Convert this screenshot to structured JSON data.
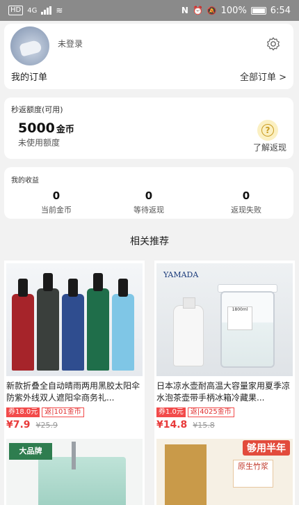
{
  "status_bar": {
    "left_chip": "HD",
    "network": "4G",
    "battery": "100%",
    "time": "6:54"
  },
  "profile": {
    "login_status": "未登录",
    "orders_title": "我的订单",
    "all_orders": "全部订单 >"
  },
  "rebate": {
    "title": "秒返额度(可用)",
    "amount": "5000",
    "unit": "金币",
    "subtitle": "未使用额度",
    "help_label": "了解返现"
  },
  "earnings": {
    "title": "我的收益",
    "items": [
      {
        "value": "0",
        "label": "当前金币"
      },
      {
        "value": "0",
        "label": "等待返现"
      },
      {
        "value": "0",
        "label": "返现失败"
      }
    ]
  },
  "recommend_title": "相关推荐",
  "products": [
    {
      "title": "新款折叠全自动晴雨两用黑胶太阳伞防紫外线双人遮阳伞商务礼...",
      "coupon": "券18.0元",
      "rebate_prefix": "返",
      "rebate": "101金币",
      "price": "¥7.9",
      "original_price": "¥25.9",
      "image": "umbrellas",
      "colors": [
        "#a6242a",
        "#3a3f3c",
        "#2f4d8f",
        "#1f6e4a",
        "#7fc6e6"
      ]
    },
    {
      "title": "日本凉水壶耐高温大容量家用夏季凉水泡茶壶带手柄冰箱冷藏果...",
      "coupon": "券1.0元",
      "rebate_prefix": "返",
      "rebate": "4025金币",
      "price": "¥14.8",
      "original_price": "¥15.8",
      "image": "kettle",
      "brand": "YAMADA",
      "jar_label": "1800ml"
    },
    {
      "image": "mop-bucket",
      "badge": "大品牌"
    },
    {
      "image": "tissues",
      "banner": "够用半年",
      "pack_text": "原生竹浆"
    }
  ]
}
